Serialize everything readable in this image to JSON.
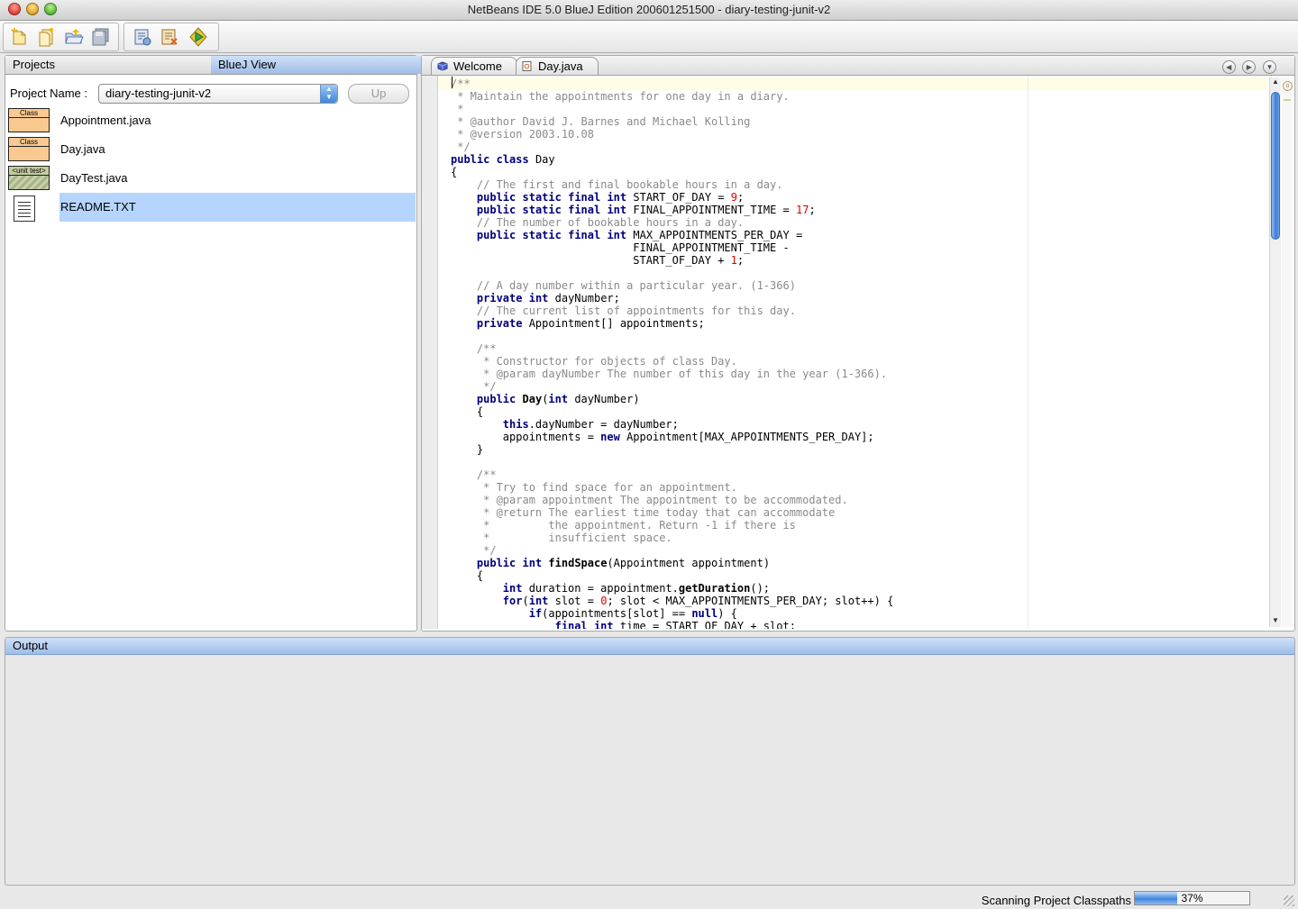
{
  "window": {
    "title": "NetBeans IDE 5.0 BlueJ Edition 200601251500 - diary-testing-junit-v2"
  },
  "toolbar": {
    "buttons": [
      {
        "name": "new-project-icon"
      },
      {
        "name": "new-file-icon"
      },
      {
        "name": "open-project-icon"
      },
      {
        "name": "save-all-icon"
      },
      {
        "name": "build-main-project-icon"
      },
      {
        "name": "clean-build-icon"
      },
      {
        "name": "run-main-project-icon"
      }
    ]
  },
  "left_panel": {
    "tabs": [
      {
        "label": "Projects"
      },
      {
        "label": "BlueJ View"
      }
    ],
    "project_name_label": "Project Name :",
    "project_name_value": "diary-testing-junit-v2",
    "up_label": "Up",
    "files": [
      {
        "name": "Appointment.java",
        "type": "class",
        "badge": "Class"
      },
      {
        "name": "Day.java",
        "type": "class",
        "badge": "Class"
      },
      {
        "name": "DayTest.java",
        "type": "unit-test",
        "badge": "<unit test>"
      },
      {
        "name": "README.TXT",
        "type": "text",
        "badge": ""
      }
    ]
  },
  "editor": {
    "tabs": [
      {
        "label": "Welcome"
      },
      {
        "label": "Day.java"
      }
    ],
    "code": [
      "/**",
      " * Maintain the appointments for one day in a diary.",
      " *",
      " * @author David J. Barnes and Michael Kolling",
      " * @version 2003.10.08",
      " */",
      "public class Day",
      "{",
      "    // The first and final bookable hours in a day.",
      "    public static final int START_OF_DAY = 9;",
      "    public static final int FINAL_APPOINTMENT_TIME = 17;",
      "    // The number of bookable hours in a day.",
      "    public static final int MAX_APPOINTMENTS_PER_DAY =",
      "                            FINAL_APPOINTMENT_TIME -",
      "                            START_OF_DAY + 1;",
      "",
      "    // A day number within a particular year. (1-366)",
      "    private int dayNumber;",
      "    // The current list of appointments for this day.",
      "    private Appointment[] appointments;",
      "",
      "    /**",
      "     * Constructor for objects of class Day.",
      "     * @param dayNumber The number of this day in the year (1-366).",
      "     */",
      "    public Day(int dayNumber)",
      "    {",
      "        this.dayNumber = dayNumber;",
      "        appointments = new Appointment[MAX_APPOINTMENTS_PER_DAY];",
      "    }",
      "",
      "    /**",
      "     * Try to find space for an appointment.",
      "     * @param appointment The appointment to be accommodated.",
      "     * @return The earliest time today that can accommodate",
      "     *         the appointment. Return -1 if there is",
      "     *         insufficient space.",
      "     */",
      "    public int findSpace(Appointment appointment)",
      "    {",
      "        int duration = appointment.getDuration();",
      "        for(int slot = 0; slot < MAX_APPOINTMENTS_PER_DAY; slot++) {",
      "            if(appointments[slot] == null) {",
      "                final int time = START_OF_DAY + slot;"
    ]
  },
  "output": {
    "tab_label": "Output"
  },
  "status": {
    "text": "Scanning Project Classpaths",
    "progress_percent_label": "37%",
    "progress_fraction": 0.37
  },
  "colors": {
    "selection": "#b5d5ff",
    "class_fill": "#f9c991",
    "keyword": "#00007f",
    "comment": "#8a8a8a",
    "number": "#dd0000",
    "accent": "#3f86dc"
  }
}
